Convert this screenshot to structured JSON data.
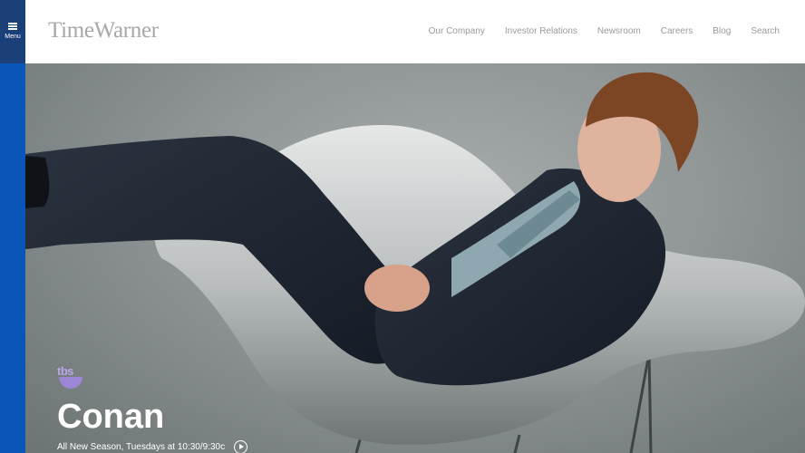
{
  "menu": {
    "label": "Menu"
  },
  "header": {
    "logo": "TimeWarner",
    "nav": [
      "Our Company",
      "Investor Relations",
      "Newsroom",
      "Careers",
      "Blog",
      "Search"
    ]
  },
  "hero": {
    "network": "tbs",
    "title": "Conan",
    "subtitle": "All New Season, Tuesdays at 10:30/9:30c"
  },
  "colors": {
    "rail": "#0a55b8",
    "menu_button": "#1b3f78",
    "logo_gray": "#a8a8a8",
    "tbs_purple": "#9c87d6"
  }
}
